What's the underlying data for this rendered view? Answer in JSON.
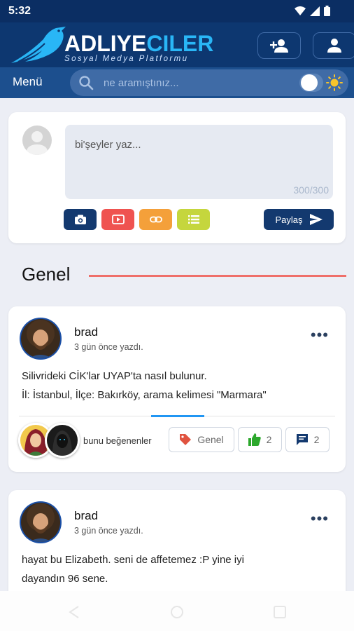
{
  "status_bar": {
    "time": "5:32"
  },
  "header": {
    "brand_main": "ADLIYE",
    "brand_accent": "CILER",
    "brand_subtitle": "Sosyal Medya Platformu",
    "buttons": [
      {
        "icon": "add-user-icon"
      },
      {
        "icon": "user-icon"
      }
    ]
  },
  "menubar": {
    "menu_label": "Menü",
    "search_placeholder": "ne aramıştınız...",
    "theme_icon": "sun-icon"
  },
  "composer": {
    "placeholder": "bi'şeyler yaz...",
    "counter": "300/300",
    "attachments": [
      {
        "icon": "camera-icon",
        "color": "#13396f"
      },
      {
        "icon": "video-icon",
        "color": "#ef5350"
      },
      {
        "icon": "link-icon",
        "color": "#f4a03a"
      },
      {
        "icon": "list-icon",
        "color": "#c5d63d"
      }
    ],
    "share_label": "Paylaş"
  },
  "section": {
    "title": "Genel",
    "accent_color": "#ef6f6a"
  },
  "posts": [
    {
      "username": "brad",
      "time": "3 gün önce yazdı.",
      "lines": [
        "Silivrideki CİK'lar  UYAP'ta  nasıl bulunur.",
        "İl: İstanbul, İlçe: Bakırköy, arama kelimesi \"Marmara\""
      ],
      "likers_label": "bunu beğenenler",
      "tag": "Genel",
      "likes": "2",
      "comments": "2"
    },
    {
      "username": "brad",
      "time": "3 gün önce yazdı.",
      "lines": [
        "hayat bu Elizabeth. seni de affetemez :P yine iyi",
        "dayandın 96 sene."
      ]
    }
  ]
}
